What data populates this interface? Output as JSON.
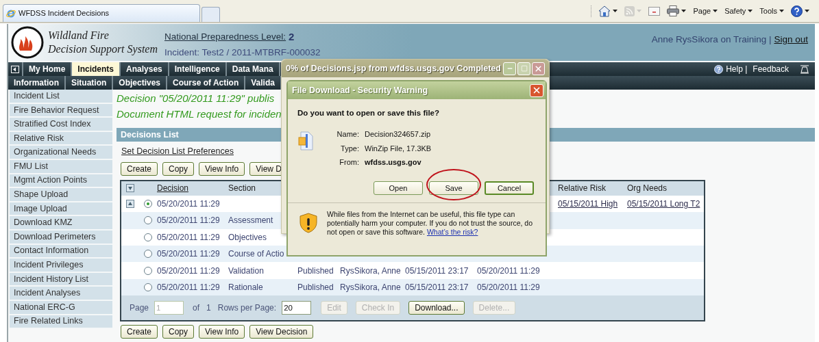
{
  "browser": {
    "tabs": [
      {
        "kind": "page",
        "title": "WFDSS Incident Decisions",
        "selected": true
      },
      {
        "kind": "new",
        "selected": false
      }
    ],
    "toolbar": [
      {
        "kind": "home",
        "dropdown": true,
        "disabled": false
      },
      {
        "kind": "feeds",
        "dropdown": true,
        "disabled": true
      },
      {
        "kind": "mail",
        "dropdown": false,
        "disabled": false
      },
      {
        "kind": "print",
        "dropdown": true,
        "disabled": false
      },
      {
        "kind": "menu",
        "label": "Page",
        "dropdown": true,
        "disabled": false
      },
      {
        "kind": "menu",
        "label": "Safety",
        "dropdown": true,
        "disabled": false
      },
      {
        "kind": "menu",
        "label": "Tools",
        "dropdown": true,
        "disabled": false
      },
      {
        "kind": "help",
        "dropdown": true,
        "disabled": false
      }
    ]
  },
  "header": {
    "logo_lines": [
      "Wildland Fire",
      "Decision Support System"
    ],
    "preparedness_label": "National Preparedness Level:",
    "preparedness_level": "2",
    "incident": "Incident: Test2 / 2011-MTBRF-000032",
    "user": "Anne RysSikora on Training |",
    "sign_out": "Sign out"
  },
  "nav": {
    "primary": [
      {
        "label": "My Home",
        "selected": false
      },
      {
        "label": "Incidents",
        "selected": true
      },
      {
        "label": "Analyses",
        "selected": false
      },
      {
        "label": "Intelligence",
        "selected": false
      },
      {
        "label": "Data Mana",
        "selected": false
      }
    ],
    "help": "Help |",
    "feedback": "Feedback",
    "secondary": [
      {
        "label": "Information",
        "selected": false
      },
      {
        "label": "Situation",
        "selected": false
      },
      {
        "label": "Objectives",
        "selected": false
      },
      {
        "label": "Course of Action",
        "selected": false
      },
      {
        "label": "Valida",
        "selected": false
      }
    ]
  },
  "sidebar": {
    "items": [
      "Incident List",
      "Fire Behavior Request",
      "Stratified Cost Index",
      "Relative Risk",
      "Organizational Needs",
      "FMU List",
      "Mgmt Action Points",
      "Shape Upload",
      "Image Upload",
      "Download KMZ",
      "Download Perimeters",
      "Contact Information",
      "Incident Privileges",
      "Incident History List",
      "Incident Analyses",
      "National ERC-G",
      "Fire Related Links"
    ]
  },
  "messages": [
    "Decision \"05/20/2011 11:29\" publis",
    "Document HTML request for inciden"
  ],
  "decisions": {
    "title": "Decisions List",
    "preferences_link": "Set Decision List Preferences",
    "top_buttons": [
      "Create",
      "Copy",
      "View Info",
      "View D"
    ],
    "table": {
      "columns": [
        {
          "label": "Decision",
          "link": true
        },
        {
          "label": "Section",
          "link": false
        },
        null,
        null,
        null,
        null,
        {
          "label": "Relative Risk",
          "link": false
        },
        {
          "label": "Org Needs",
          "link": false
        }
      ],
      "rows": [
        {
          "kind": "parent",
          "selected": true,
          "cells": [
            {
              "text": "05/20/2011 11:29",
              "link": false
            },
            null,
            null,
            null,
            null,
            null,
            {
              "text": "05/15/2011 High",
              "link": true
            },
            {
              "text": "05/15/2011 Long T2",
              "link": true
            }
          ]
        },
        {
          "kind": "child",
          "selected": false,
          "cells": [
            {
              "text": "05/20/2011 11:29",
              "link": false
            },
            {
              "text": "Assessment",
              "link": false
            },
            null,
            null,
            null,
            null,
            null,
            null
          ]
        },
        {
          "kind": "child",
          "selected": false,
          "cells": [
            {
              "text": "05/20/2011 11:29",
              "link": false
            },
            {
              "text": "Objectives",
              "link": false
            },
            null,
            null,
            null,
            null,
            null,
            null
          ]
        },
        {
          "kind": "child",
          "selected": false,
          "cells": [
            {
              "text": "05/20/2011 11:29",
              "link": false
            },
            {
              "text": "Course of Actio",
              "link": false
            },
            null,
            null,
            null,
            null,
            null,
            null
          ]
        },
        {
          "kind": "child",
          "selected": false,
          "cells": [
            {
              "text": "05/20/2011 11:29",
              "link": false
            },
            {
              "text": "Validation",
              "link": false
            },
            {
              "text": "Published",
              "link": false
            },
            {
              "text": "RysSikora, Anne",
              "link": false
            },
            {
              "text": "05/15/2011 23:17",
              "link": false
            },
            {
              "text": "05/20/2011 11:29",
              "link": false
            },
            null,
            null
          ]
        },
        {
          "kind": "child",
          "selected": false,
          "cells": [
            {
              "text": "05/20/2011 11:29",
              "link": false
            },
            {
              "text": "Rationale",
              "link": false
            },
            {
              "text": "Published",
              "link": false
            },
            {
              "text": "RysSikora, Anne",
              "link": false
            },
            {
              "text": "05/15/2011 23:17",
              "link": false
            },
            {
              "text": "05/20/2011 11:29",
              "link": false
            },
            null,
            null
          ]
        }
      ]
    },
    "pager": {
      "page_label": "Page",
      "page_value": "1",
      "of_label": "of",
      "page_count": "1",
      "rows_label": "Rows per Page:",
      "rows_value": "20",
      "buttons": [
        {
          "label": "Edit",
          "disabled": true
        },
        {
          "label": "Check In",
          "disabled": true
        },
        {
          "label": "Download...",
          "disabled": false
        },
        {
          "label": "Delete...",
          "disabled": true
        }
      ]
    },
    "bottom_buttons": [
      "Create",
      "Copy",
      "View Info",
      "View Decision"
    ]
  },
  "progress_dialog": {
    "title": "0% of Decisions.jsp from wfdss.usgs.gov Completed",
    "maximize_disabled": true
  },
  "file_dialog": {
    "title": "File Download - Security Warning",
    "question": "Do you want to open or save this file?",
    "fields": [
      {
        "label": "Name:",
        "value": "Decision324657.zip",
        "bold": false
      },
      {
        "label": "Type:",
        "value": "WinZip File, 17.3KB",
        "bold": false
      },
      {
        "label": "From:",
        "value": "wfdss.usgs.gov",
        "bold": true
      }
    ],
    "buttons": [
      {
        "label": "Open",
        "default": false,
        "circled": false
      },
      {
        "label": "Save",
        "default": false,
        "circled": true
      },
      {
        "label": "Cancel",
        "default": true,
        "circled": false
      }
    ],
    "warning": "While files from the Internet can be useful, this file type can potentially harm your computer. If you do not trust the source, do not open or save this software.",
    "risk_link": "What’s the risk?"
  }
}
